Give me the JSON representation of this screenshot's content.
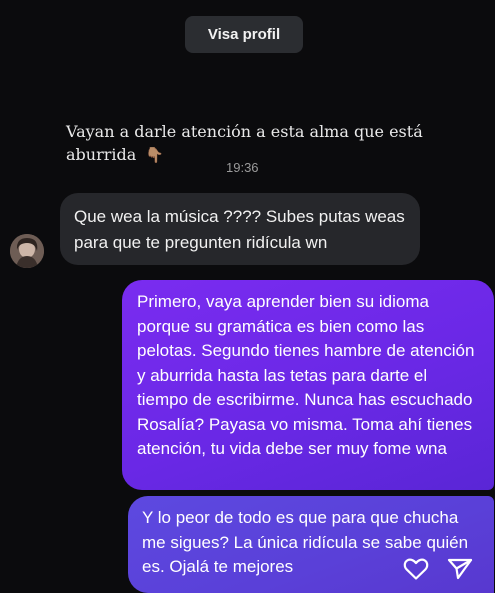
{
  "header": {
    "view_profile_label": "Visa profil"
  },
  "story_reply": {
    "text": "Vayan a darle atención a esta alma que está aburrida",
    "emoji": "👇🏽",
    "time": "19:36"
  },
  "messages": [
    {
      "sender": "them",
      "text": "Que wea la música ???? Subes putas weas para que te pregunten ridícula wn"
    },
    {
      "sender": "me",
      "text": "Primero, vaya aprender bien su idioma porque su gramática es bien como las pelotas. Segundo tienes hambre de atención y aburrida hasta las tetas para darte el tiempo de escribirme. Nunca has escuchado Rosalía? Payasa vo misma. Toma ahí tienes atención, tu vida debe ser muy fome wna"
    },
    {
      "sender": "me",
      "text": "Y lo peor de todo es que para que chucha me sigues? La única ridícula se sabe quién es. Ojalá te mejores"
    }
  ],
  "icons": {
    "like": "heart-icon",
    "share": "send-icon"
  },
  "colors": {
    "background": "#0b0b0d",
    "incoming_bubble": "#26272b",
    "outgoing_bubble_top": "#7a2cf0",
    "outgoing_bubble_bottom": "#5a40d8",
    "profile_button": "#2b2d31"
  }
}
